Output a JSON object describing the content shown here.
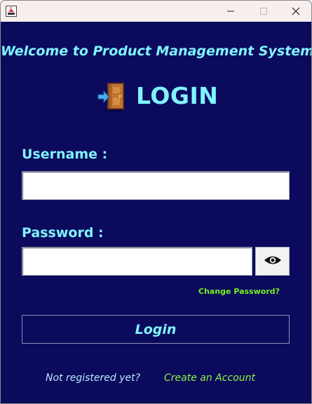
{
  "window": {
    "icons": {
      "app": "java-app-icon",
      "minimize": "minimize-icon",
      "maximize": "maximize-icon",
      "close": "close-icon"
    }
  },
  "main": {
    "welcome_text": "Welcome to Product Management System",
    "heading": "LOGIN",
    "heading_icon": "door-exit-icon"
  },
  "form": {
    "username_label": "Username :",
    "username_value": "",
    "password_label": "Password :",
    "password_value": "",
    "show_password_icon": "eye-icon",
    "change_password_link": "Change Password?",
    "login_button": "Login"
  },
  "footer": {
    "not_registered_text": "Not registered yet?",
    "create_account_link": "Create an Account"
  },
  "colors": {
    "background": "#0b0a5c",
    "titlebar": "#f6efed",
    "accent_cyan": "#7ff3ff",
    "link_green": "#74f020"
  }
}
